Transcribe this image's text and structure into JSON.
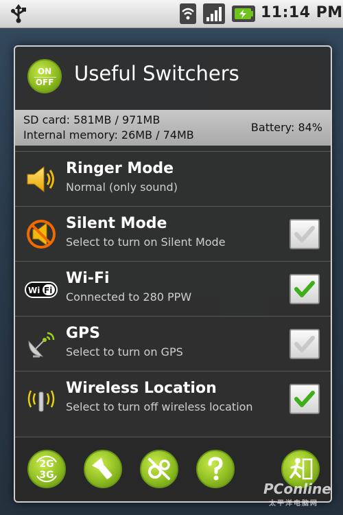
{
  "status_bar": {
    "time": "11:14 PM"
  },
  "dialog": {
    "title": "Useful Switchers",
    "app_icon": {
      "on": "ON",
      "off": "OFF"
    },
    "info": {
      "sd_card": "SD card: 581MB / 971MB",
      "internal_memory": "Internal memory: 26MB / 74MB",
      "battery": "Battery: 84%"
    },
    "rows": [
      {
        "name": "Ringer Mode",
        "desc": "Normal (only sound)",
        "icon": "speaker-icon",
        "has_checkbox": false
      },
      {
        "name": "Silent Mode",
        "desc": "Select to turn on Silent Mode",
        "icon": "muted-speaker-icon",
        "checked": false
      },
      {
        "name": "Wi-Fi",
        "desc": "Connected to 280 PPW",
        "icon": "wifi-icon",
        "icon_text": "WiFi",
        "checked": true
      },
      {
        "name": "GPS",
        "desc": "Select to turn on GPS",
        "icon": "satellite-dish-icon",
        "checked": false
      },
      {
        "name": "Wireless Location",
        "desc": "Select to turn off wireless location",
        "icon": "antenna-icon",
        "checked": true
      }
    ],
    "toolbar": {
      "network_mode": {
        "line1": "2G",
        "line2": "3G"
      },
      "buttons": [
        "network-mode-icon",
        "flashlight-icon",
        "settings-tools-icon",
        "help-icon",
        "exit-icon"
      ]
    }
  },
  "watermark": {
    "brand": "PConline",
    "sub": "太平洋电脑网"
  },
  "colors": {
    "accent_green": "#8dbb1f",
    "check_green": "#3fae1c",
    "dialog_bg": "#303030"
  }
}
